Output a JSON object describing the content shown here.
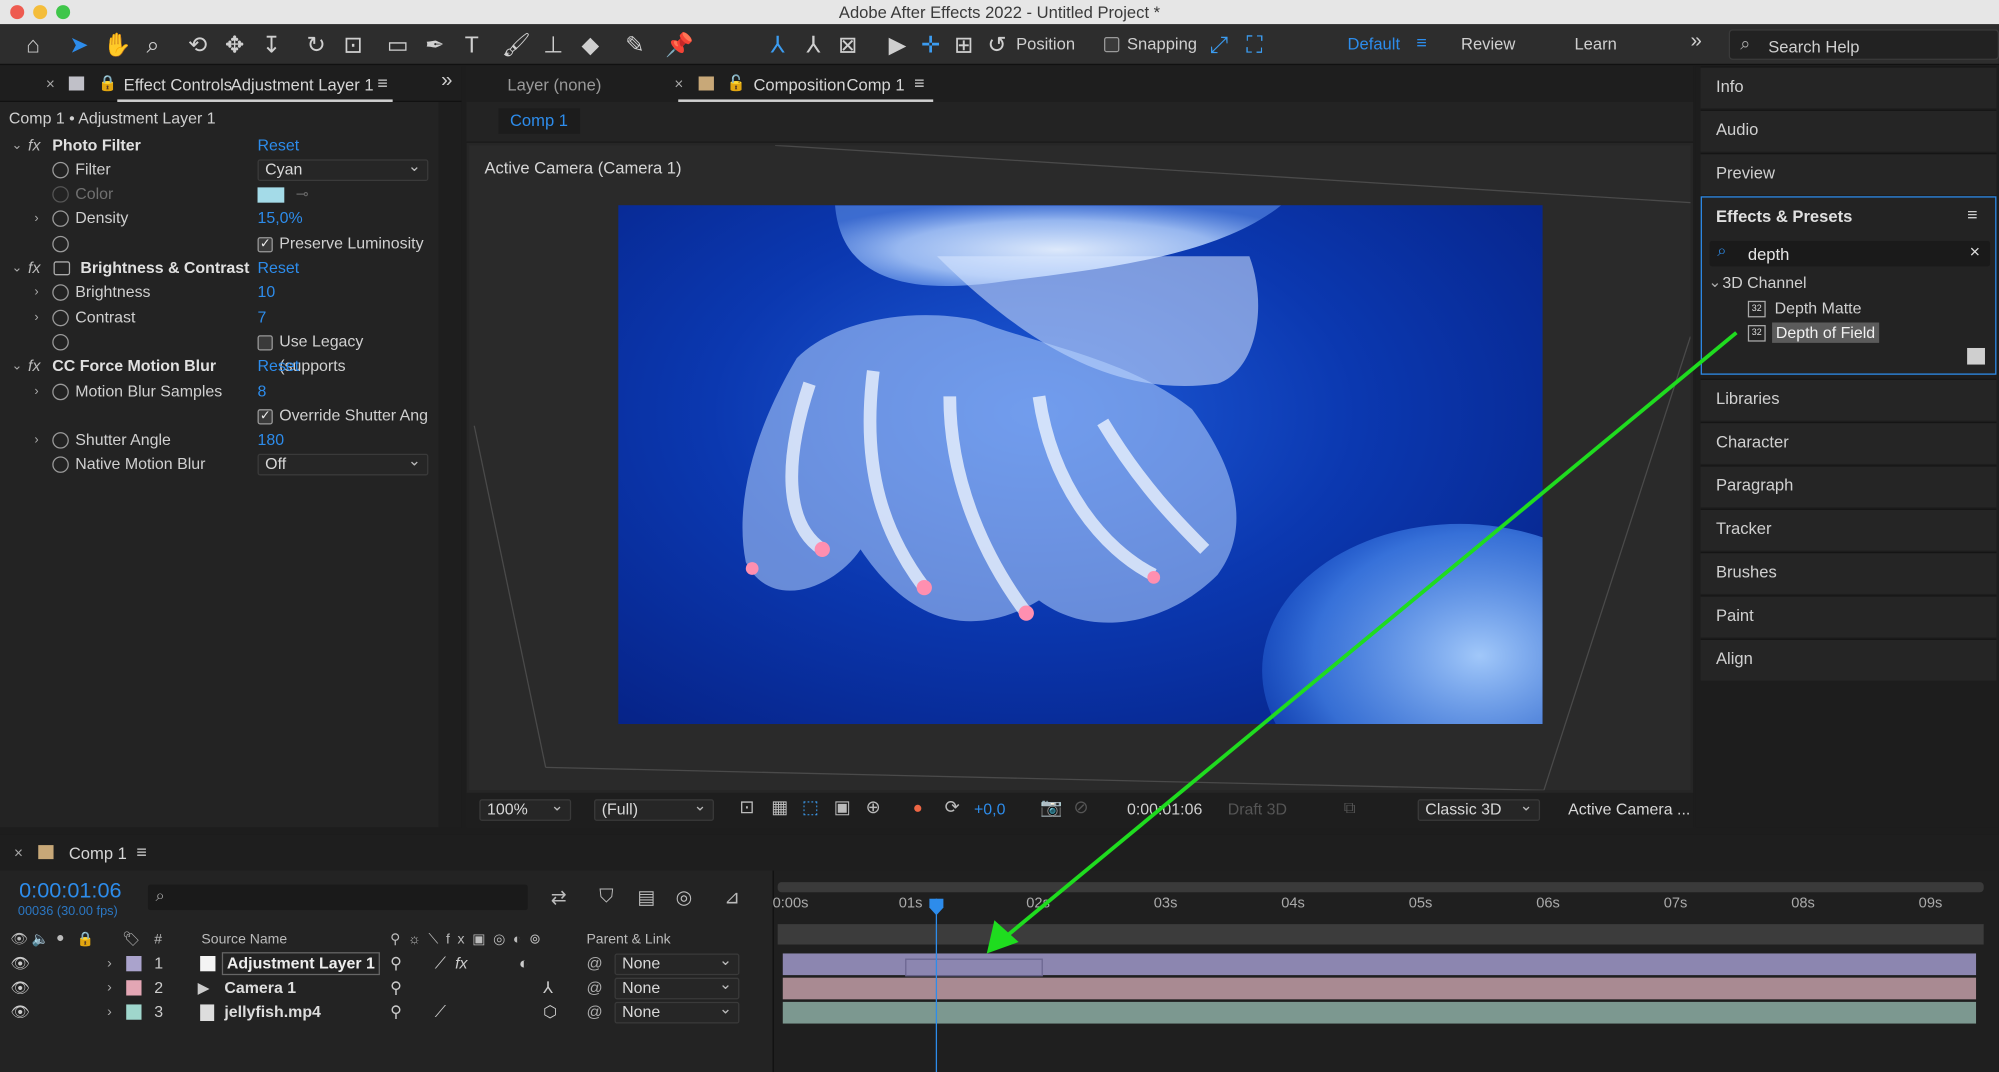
{
  "app": {
    "window_title": "Adobe After Effects 2022 - Untitled Project *"
  },
  "toolbar": {
    "position_label": "Position",
    "snapping_label": "Snapping",
    "workspaces": [
      "Default",
      "Review",
      "Learn"
    ],
    "search_placeholder": "Search Help"
  },
  "effect_controls": {
    "tab_prefix": "Effect Controls",
    "tab_layer": "Adjustment Layer 1",
    "breadcrumb": "Comp 1 • Adjustment Layer 1",
    "reset_label": "Reset",
    "effects": [
      {
        "name": "Photo Filter",
        "props": [
          {
            "label": "Filter",
            "value": "Cyan"
          },
          {
            "label": "Color",
            "value": "#a4dbe8"
          },
          {
            "label": "Density",
            "value": "15,0%"
          },
          {
            "label": "Preserve Luminosity",
            "checked": true
          }
        ]
      },
      {
        "name": "Brightness & Contrast",
        "props": [
          {
            "label": "Brightness",
            "value": "10"
          },
          {
            "label": "Contrast",
            "value": "7"
          },
          {
            "label": "Use Legacy (supports",
            "checked": false
          }
        ]
      },
      {
        "name": "CC Force Motion Blur",
        "props": [
          {
            "label": "Motion Blur Samples",
            "value": "8"
          },
          {
            "label": "Override Shutter Ang",
            "checked": true
          },
          {
            "label": "Shutter Angle",
            "value": "180"
          },
          {
            "label": "Native Motion Blur",
            "value": "Off"
          }
        ]
      }
    ]
  },
  "viewer": {
    "layer_tab": "Layer (none)",
    "comp_tab_prefix": "Composition",
    "comp_tab_name": "Comp 1",
    "comp_chip": "Comp 1",
    "active_camera_label": "Active Camera (Camera 1)",
    "zoom": "100%",
    "resolution": "(Full)",
    "exposure": "+0,0",
    "timecode": "0:00:01:06",
    "draft3d": "Draft 3D",
    "renderer": "Classic 3D",
    "view": "Active Camera ..."
  },
  "right_panel": {
    "items_top": [
      "Info",
      "Audio",
      "Preview"
    ],
    "effects_presets": {
      "title": "Effects & Presets",
      "search_value": "depth",
      "category": "3D Channel",
      "results": [
        "Depth Matte",
        "Depth of Field"
      ],
      "selected": "Depth of Field"
    },
    "items_bottom": [
      "Libraries",
      "Character",
      "Paragraph",
      "Tracker",
      "Brushes",
      "Paint",
      "Align"
    ]
  },
  "timeline": {
    "tab_name": "Comp 1",
    "timecode": "0:00:01:06",
    "frame_info": "00036 (30.00 fps)",
    "col_number": "#",
    "col_source": "Source Name",
    "col_parent": "Parent & Link",
    "ticks": [
      "0:00s",
      "01s",
      "02s",
      "03s",
      "04s",
      "05s",
      "06s",
      "07s",
      "08s",
      "09s"
    ],
    "layers": [
      {
        "num": "1",
        "name": "Adjustment Layer 1",
        "label_color": "#aaa3cc",
        "parent": "None",
        "bar_color": "#8c86b0"
      },
      {
        "num": "2",
        "name": "Camera 1",
        "label_color": "#e3a6b4",
        "parent": "None",
        "bar_color": "#a98a92"
      },
      {
        "num": "3",
        "name": "jellyfish.mp4",
        "label_color": "#9fd6cc",
        "parent": "None",
        "bar_color": "#7c9890"
      }
    ]
  }
}
